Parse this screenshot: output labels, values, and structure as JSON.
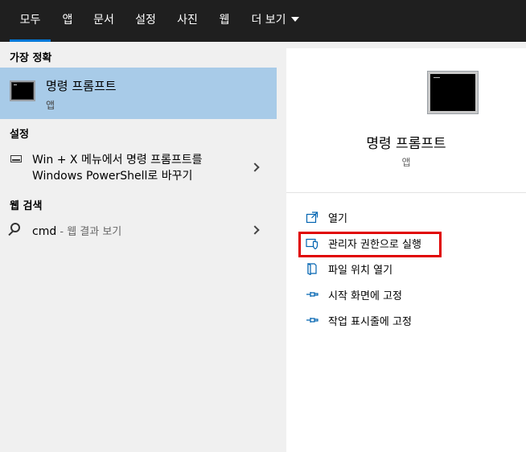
{
  "tabs": [
    {
      "label": "모두",
      "active": true
    },
    {
      "label": "앱"
    },
    {
      "label": "문서"
    },
    {
      "label": "설정"
    },
    {
      "label": "사진"
    },
    {
      "label": "웹"
    },
    {
      "label": "더 보기"
    }
  ],
  "left": {
    "best_match_header": "가장 정확",
    "best_match": {
      "title": "명령 프롬프트",
      "subtitle": "앱",
      "icon": "command-prompt-icon"
    },
    "settings_header": "설정",
    "settings_item": {
      "line1": "Win + X 메뉴에서 명령 프롬프트를",
      "line2": "Windows PowerShell로 바꾸기"
    },
    "web_header": "웹 검색",
    "web_item": {
      "query": "cmd",
      "suffix": " - 웹 결과 보기"
    }
  },
  "right": {
    "title": "명령 프롬프트",
    "subtitle": "앱",
    "actions": [
      {
        "label": "열기",
        "icon": "open-icon"
      },
      {
        "label": "관리자 권한으로 실행",
        "icon": "shield-icon"
      },
      {
        "label": "파일 위치 열기",
        "icon": "file-location-icon"
      },
      {
        "label": "시작 화면에 고정",
        "icon": "pin-icon"
      },
      {
        "label": "작업 표시줄에 고정",
        "icon": "pin-icon"
      }
    ]
  },
  "colors": {
    "accent": "#0078d7",
    "selection": "#a8cbe8",
    "highlight_box": "#e00000"
  }
}
